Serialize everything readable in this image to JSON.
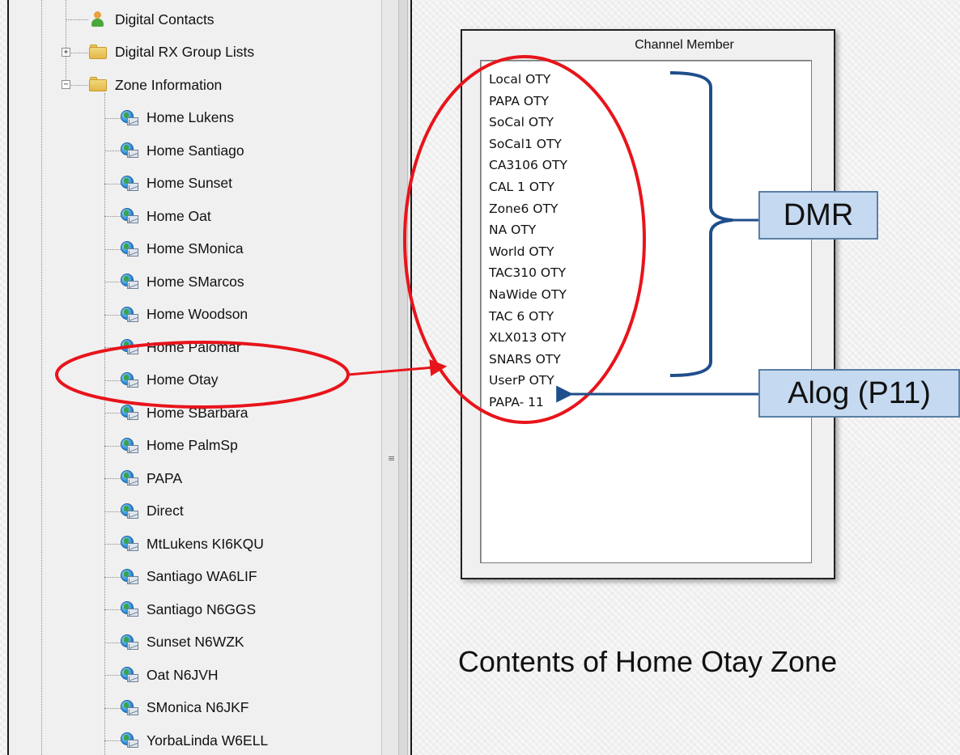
{
  "tree": {
    "items": [
      {
        "label": "Digital Contacts",
        "icon": "contact-icon",
        "expander": ""
      },
      {
        "label": "Digital RX Group Lists",
        "icon": "folder-icon",
        "expander": "+"
      },
      {
        "label": "Zone Information",
        "icon": "folder-icon",
        "expander": "−"
      },
      {
        "label": "Home Lukens",
        "icon": "zone-icon"
      },
      {
        "label": "Home Santiago",
        "icon": "zone-icon"
      },
      {
        "label": "Home Sunset",
        "icon": "zone-icon"
      },
      {
        "label": "Home Oat",
        "icon": "zone-icon"
      },
      {
        "label": "Home SMonica",
        "icon": "zone-icon"
      },
      {
        "label": "Home SMarcos",
        "icon": "zone-icon"
      },
      {
        "label": "Home Woodson",
        "icon": "zone-icon"
      },
      {
        "label": "Home Palomar",
        "icon": "zone-icon"
      },
      {
        "label": "Home Otay",
        "icon": "zone-icon"
      },
      {
        "label": "Home SBarbara",
        "icon": "zone-icon"
      },
      {
        "label": "Home PalmSp",
        "icon": "zone-icon"
      },
      {
        "label": "PAPA",
        "icon": "zone-icon"
      },
      {
        "label": "Direct",
        "icon": "zone-icon"
      },
      {
        "label": "MtLukens KI6KQU",
        "icon": "zone-icon"
      },
      {
        "label": "Santiago WA6LIF",
        "icon": "zone-icon"
      },
      {
        "label": "Santiago N6GGS",
        "icon": "zone-icon"
      },
      {
        "label": "Sunset N6WZK",
        "icon": "zone-icon"
      },
      {
        "label": "Oat N6JVH",
        "icon": "zone-icon"
      },
      {
        "label": "SMonica N6JKF",
        "icon": "zone-icon"
      },
      {
        "label": "YorbaLinda W6ELL",
        "icon": "zone-icon"
      }
    ],
    "splitter_grip": "≡"
  },
  "member_panel": {
    "title": "Channel Member",
    "members": [
      "Local OTY",
      "PAPA OTY",
      "SoCal OTY",
      "SoCal1 OTY",
      "CA3106 OTY",
      "CAL 1 OTY",
      "Zone6 OTY",
      "NA OTY",
      "World OTY",
      "TAC310 OTY",
      "NaWide OTY",
      "TAC 6 OTY",
      "XLX013 OTY",
      "SNARS OTY",
      "UserP OTY",
      "PAPA- 11"
    ]
  },
  "annotations": {
    "dmr_label": "DMR",
    "analog_label": "Alog (P11)",
    "caption": "Contents of Home Otay Zone",
    "highlight_color": "#e8141b",
    "bracket_color": "#1f4e8c",
    "callout_fill": "#c5d9f0"
  }
}
